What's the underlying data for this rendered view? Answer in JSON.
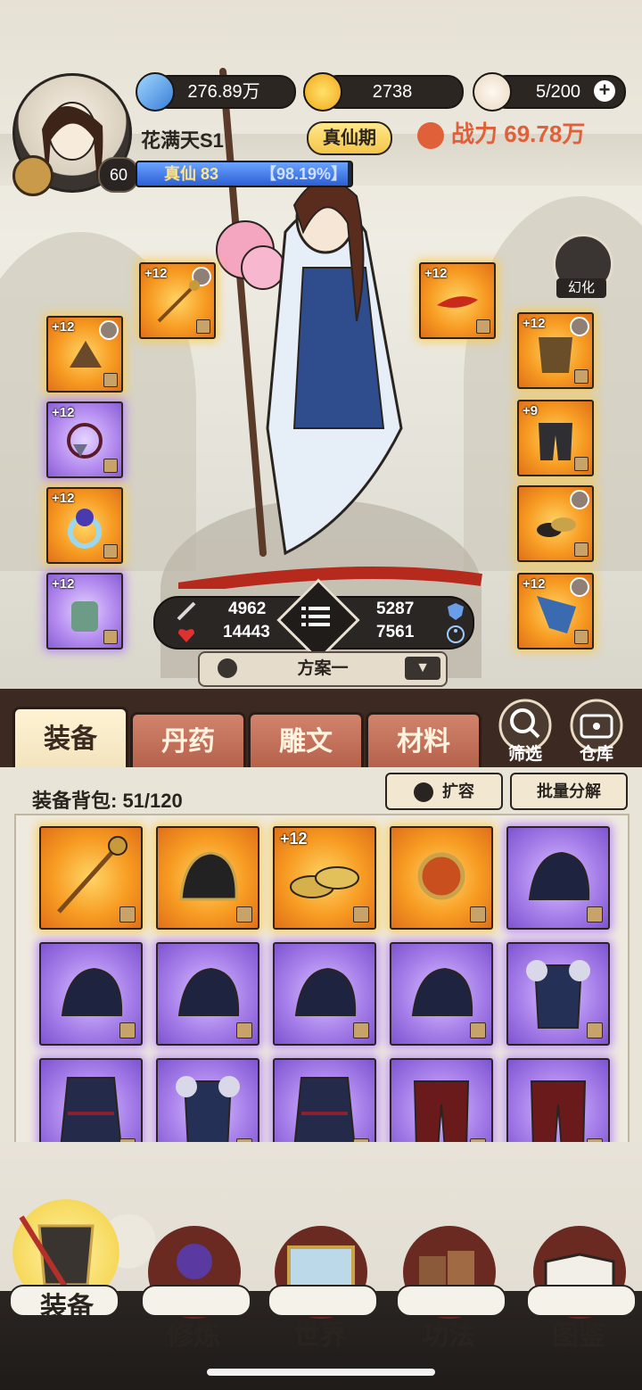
{
  "resources": {
    "spirit_stone": "276.89万",
    "gold": "2738",
    "stamina": "5/200"
  },
  "player": {
    "name": "花满天S1",
    "level": "60",
    "realm": "真仙 83",
    "exp_percent": "【98.19%】",
    "exp_fraction": 0.9819,
    "stage": "真仙期",
    "power_label": "战力",
    "power_value": "69.78万"
  },
  "transform_label": "幻化",
  "equipped": {
    "left_top": "+12",
    "right_top": "+12",
    "left_col": [
      "+12",
      "+12",
      "+12",
      "+12"
    ],
    "right_col": [
      "+12",
      "+9",
      "",
      "+12"
    ]
  },
  "stats": {
    "attack": "4962",
    "defense": "5287",
    "hp": "14443",
    "speed": "7561"
  },
  "plan": "方案一",
  "tabs": [
    "装备",
    "丹药",
    "雕文",
    "材料"
  ],
  "round_buttons": [
    "筛选",
    "仓库"
  ],
  "bag": {
    "label": "装备背包: 51/120",
    "expand_label": "扩容",
    "batch_label": "批量分解",
    "items": [
      {
        "plus": ""
      },
      {
        "plus": ""
      },
      {
        "plus": "+12"
      },
      {
        "plus": ""
      },
      {
        "plus": ""
      },
      {
        "plus": ""
      },
      {
        "plus": ""
      },
      {
        "plus": ""
      },
      {
        "plus": ""
      },
      {
        "plus": ""
      },
      {
        "plus": ""
      },
      {
        "plus": ""
      },
      {
        "plus": ""
      },
      {
        "plus": ""
      },
      {
        "plus": ""
      }
    ]
  },
  "bottom_nav": [
    "装备",
    "修炼",
    "世界",
    "功法",
    "图鉴"
  ],
  "colors": {
    "orange_rarity": "#f79b22",
    "purple_rarity": "#a880ea",
    "power_text": "#e0603a",
    "tab_active": "#f2e3bc",
    "tab_inactive": "#b4604a"
  }
}
